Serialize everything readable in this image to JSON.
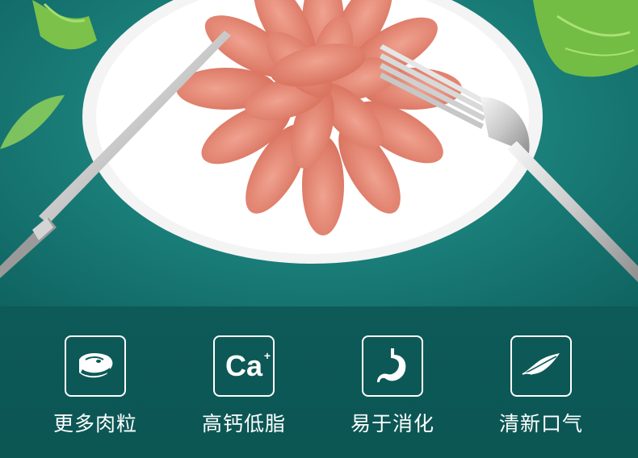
{
  "hero": {
    "image": "sausage-slices-on-plate-with-knife-and-fork"
  },
  "features": [
    {
      "icon": "meat-icon",
      "label": "更多肉粒"
    },
    {
      "icon": "calcium-icon",
      "icon_text": "Ca",
      "label": "高钙低脂"
    },
    {
      "icon": "stomach-icon",
      "label": "易于消化"
    },
    {
      "icon": "leaf-icon",
      "label": "清新口气"
    }
  ],
  "colors": {
    "background": "#0f5e5c",
    "hero_center": "#2fa39c",
    "sausage": "#e88a7a",
    "icon_stroke": "#ffffff"
  }
}
